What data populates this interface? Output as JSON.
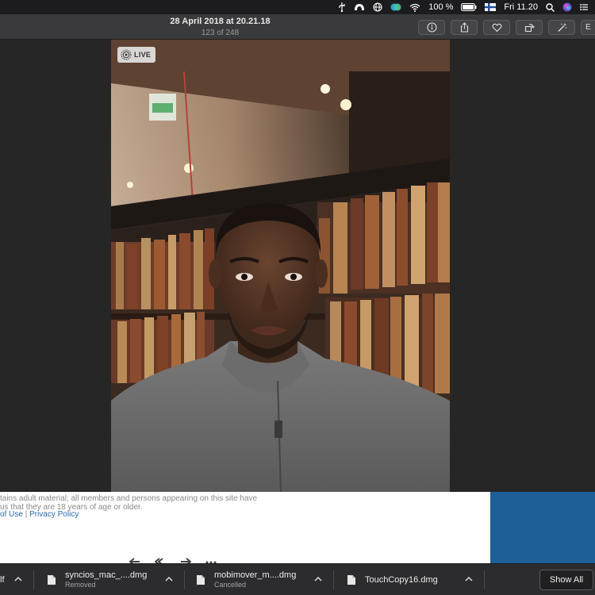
{
  "menubar": {
    "battery": "100 %",
    "clock": "Fri 11.20"
  },
  "toolbar": {
    "photo_date": "28 April 2018 at 20.21.18",
    "photo_count": "123 of 248",
    "edit_partial": "E"
  },
  "photo": {
    "live_label": "LIVE"
  },
  "browser": {
    "disclaimer_line1": "tains adult material; all members and persons appearing on this site have",
    "disclaimer_line2": "us that they are 18 years of age or older.",
    "link_terms": "of Use",
    "link_separator": "|",
    "link_privacy": "Privacy Policy"
  },
  "downloads": {
    "partial_name": "lf",
    "items": [
      {
        "name": "syncios_mac_....dmg",
        "status": "Removed"
      },
      {
        "name": "mobimover_m....dmg",
        "status": "Cancelled"
      },
      {
        "name": "TouchCopy16.dmg",
        "status": ""
      }
    ],
    "show_all_label": "Show All"
  },
  "colors": {
    "menubar_bg": "#1c1c1e",
    "toolbar_bg": "#3a3a3c",
    "viewer_bg": "#262626",
    "link_blue": "#2b6cb0",
    "browser_side_blue": "#1f5f97",
    "download_bar_bg": "#2c2c2e"
  }
}
